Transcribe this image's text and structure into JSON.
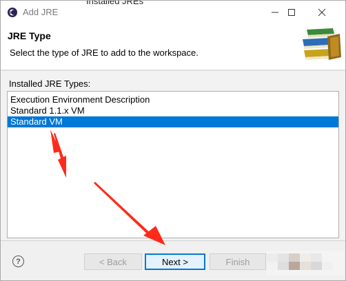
{
  "window": {
    "title": "Add JRE",
    "background_fragment": "Installed JREs"
  },
  "header": {
    "title": "JRE Type",
    "description": "Select the type of JRE to add to the workspace.",
    "image_icon": "books-stack-icon"
  },
  "jre_types": {
    "label": "Installed JRE Types:",
    "items": [
      {
        "label": "Execution Environment Description",
        "selected": false
      },
      {
        "label": "Standard 1.1.x VM",
        "selected": false
      },
      {
        "label": "Standard VM",
        "selected": true
      }
    ]
  },
  "footer": {
    "help_glyph": "?",
    "back_label": "< Back",
    "next_label": "Next >",
    "finish_label": "Finish"
  },
  "colors": {
    "selection": "#0078d7",
    "annotation_arrow": "#ff2a1a"
  }
}
